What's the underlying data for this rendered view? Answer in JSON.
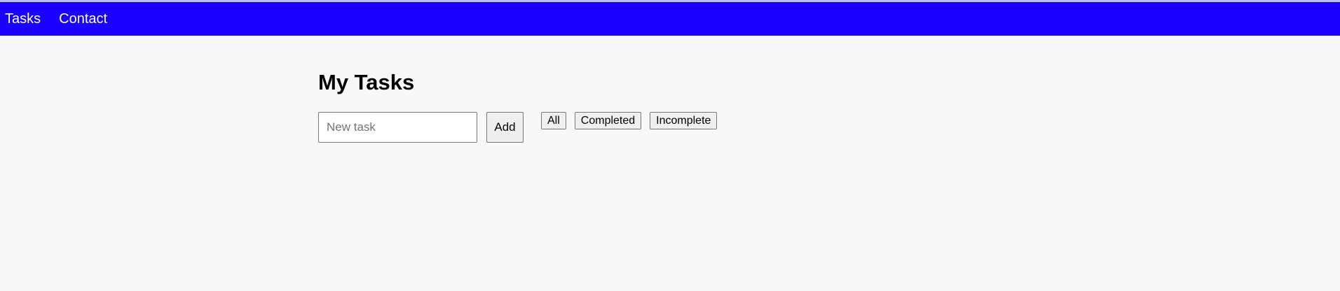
{
  "nav": {
    "items": [
      {
        "label": "Tasks"
      },
      {
        "label": "Contact"
      }
    ]
  },
  "main": {
    "title": "My Tasks",
    "task_input": {
      "placeholder": "New task",
      "value": ""
    },
    "add_label": "Add",
    "filters": [
      {
        "label": "All"
      },
      {
        "label": "Completed"
      },
      {
        "label": "Incomplete"
      }
    ]
  },
  "colors": {
    "navbar": "#1900ff",
    "nav_text": "#ffffff",
    "background": "#f8f8f8",
    "button_bg": "#efefef"
  }
}
